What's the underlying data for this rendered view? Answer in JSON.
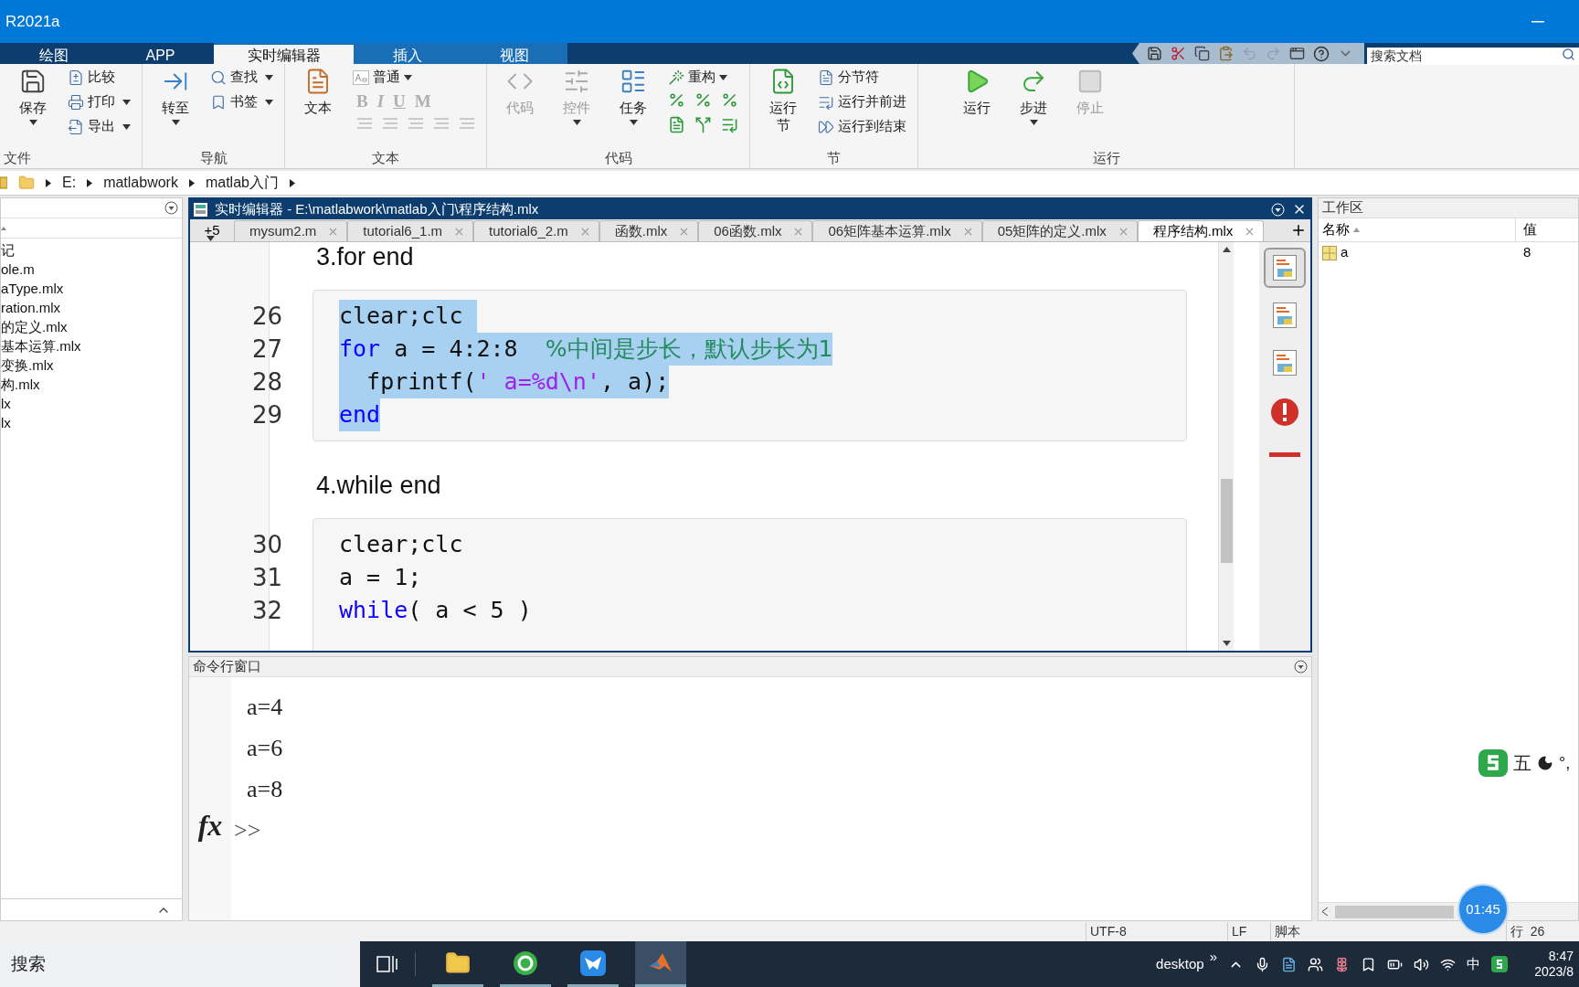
{
  "window": {
    "title": "R2021a"
  },
  "ribbon": {
    "tabs": [
      {
        "label": "绘图",
        "selected": false,
        "kind": "main"
      },
      {
        "label": "APP",
        "selected": false,
        "kind": "main"
      },
      {
        "label": "实时编辑器",
        "selected": true,
        "kind": "contextual"
      },
      {
        "label": "插入",
        "selected": false,
        "kind": "contextual"
      },
      {
        "label": "视图",
        "selected": false,
        "kind": "contextual"
      }
    ],
    "search": {
      "placeholder": "搜索文档"
    },
    "groups": [
      {
        "label": "文件",
        "columns": [
          {
            "kind": "large",
            "label": "保存",
            "dropdown": true,
            "disabled": false
          },
          {
            "kind": "stack",
            "items": [
              {
                "label": "比较",
                "dropdown": false
              },
              {
                "label": "打印",
                "dropdown": true
              },
              {
                "label": "导出",
                "dropdown": true
              }
            ]
          }
        ]
      },
      {
        "label": "导航",
        "columns": [
          {
            "kind": "large",
            "label": "转至",
            "dropdown": true,
            "disabled": false
          },
          {
            "kind": "stack",
            "items": [
              {
                "label": "查找",
                "dropdown": true
              },
              {
                "label": "书签",
                "dropdown": true
              }
            ]
          }
        ]
      },
      {
        "label": "文本",
        "columns": [
          {
            "kind": "large",
            "label": "文本",
            "dropdown": false,
            "disabled": false
          },
          {
            "kind": "format",
            "style": "普通",
            "letters": [
              "B",
              "I",
              "U",
              "M"
            ]
          }
        ]
      },
      {
        "label": "代码",
        "columns": [
          {
            "kind": "large",
            "label": "代码",
            "dropdown": false,
            "disabled": true
          },
          {
            "kind": "large",
            "label": "控件",
            "dropdown": true,
            "disabled": true
          },
          {
            "kind": "large",
            "label": "任务",
            "dropdown": true,
            "disabled": false
          },
          {
            "kind": "refactor",
            "label": "重构"
          }
        ]
      },
      {
        "label": "节",
        "columns": [
          {
            "kind": "large",
            "label": "运行节",
            "dropdown": false,
            "disabled": false
          },
          {
            "kind": "stack",
            "items": [
              {
                "label": "分节符",
                "dropdown": false
              },
              {
                "label": "运行并前进",
                "dropdown": false
              },
              {
                "label": "运行到结束",
                "dropdown": false
              }
            ]
          }
        ]
      },
      {
        "label": "运行",
        "columns": [
          {
            "kind": "large",
            "label": "运行",
            "dropdown": false,
            "disabled": false
          },
          {
            "kind": "large",
            "label": "步进",
            "dropdown": true,
            "disabled": false
          },
          {
            "kind": "large",
            "label": "停止",
            "dropdown": false,
            "disabled": true
          }
        ]
      }
    ]
  },
  "address_bar": {
    "parts": [
      "E:",
      "matlabwork",
      "matlab入门"
    ]
  },
  "file_browser": {
    "files": [
      "记",
      "ole.m",
      "aType.mlx",
      "ration.mlx",
      "的定义.mlx",
      "基本运算.mlx",
      "变换.mlx",
      "构.mlx",
      "lx",
      "lx"
    ]
  },
  "editor": {
    "title": "实时编辑器 - E:\\matlabwork\\matlab入门\\程序结构.mlx",
    "overflow_tabs": "+5",
    "tabs": [
      {
        "label": "mysum2.m",
        "selected": false
      },
      {
        "label": "tutorial6_1.m",
        "selected": false
      },
      {
        "label": "tutorial6_2.m",
        "selected": false
      },
      {
        "label": "函数.mlx",
        "selected": false
      },
      {
        "label": "06函数.mlx",
        "selected": false
      },
      {
        "label": "06矩阵基本运算.mlx",
        "selected": false
      },
      {
        "label": "05矩阵的定义.mlx",
        "selected": false
      },
      {
        "label": "程序结构.mlx",
        "selected": true
      }
    ],
    "sections": [
      {
        "heading": "3.for end",
        "lines": [
          {
            "number": "26",
            "selected": true,
            "tokens": [
              {
                "kind": "plain",
                "text": "clear;clc "
              }
            ]
          },
          {
            "number": "27",
            "selected": true,
            "tokens": [
              {
                "kind": "keyword",
                "text": "for"
              },
              {
                "kind": "plain",
                "text": " a = 4:2:8  "
              },
              {
                "kind": "comment",
                "text": "%中间是步长，默认步长为1"
              }
            ]
          },
          {
            "number": "28",
            "selected": true,
            "tokens": [
              {
                "kind": "plain",
                "text": "  fprintf("
              },
              {
                "kind": "string",
                "text": "' a=%d\\n'"
              },
              {
                "kind": "plain",
                "text": ", a);"
              }
            ]
          },
          {
            "number": "29",
            "selected": true,
            "tokens": [
              {
                "kind": "keyword",
                "text": "end"
              }
            ]
          }
        ]
      },
      {
        "heading": "4.while end",
        "lines": [
          {
            "number": "30",
            "selected": false,
            "tokens": [
              {
                "kind": "plain",
                "text": "clear;clc"
              }
            ]
          },
          {
            "number": "31",
            "selected": false,
            "tokens": [
              {
                "kind": "plain",
                "text": "a = 1;"
              }
            ]
          },
          {
            "number": "32",
            "selected": false,
            "tokens": [
              {
                "kind": "keyword",
                "text": "while"
              },
              {
                "kind": "plain",
                "text": "( a < 5 )"
              }
            ]
          }
        ]
      }
    ]
  },
  "command_window": {
    "title": "命令行窗口",
    "output": [
      "a=4",
      "a=6",
      "a=8"
    ],
    "fx": "fx",
    "prompt": ">>"
  },
  "workspace": {
    "title": "工作区",
    "columns": [
      "名称",
      "值"
    ],
    "rows": [
      {
        "name": "a",
        "value": "8"
      }
    ]
  },
  "status_bar": [
    "UTF-8",
    "LF",
    "脚本",
    "行  26"
  ],
  "timer": "01:45",
  "ime": {
    "mode": "五",
    "punct": "°,"
  },
  "taskbar": {
    "search": "搜索",
    "toolbar": "desktop",
    "more": "»",
    "lang": "中",
    "time": "8:47",
    "date": "2023/8"
  }
}
